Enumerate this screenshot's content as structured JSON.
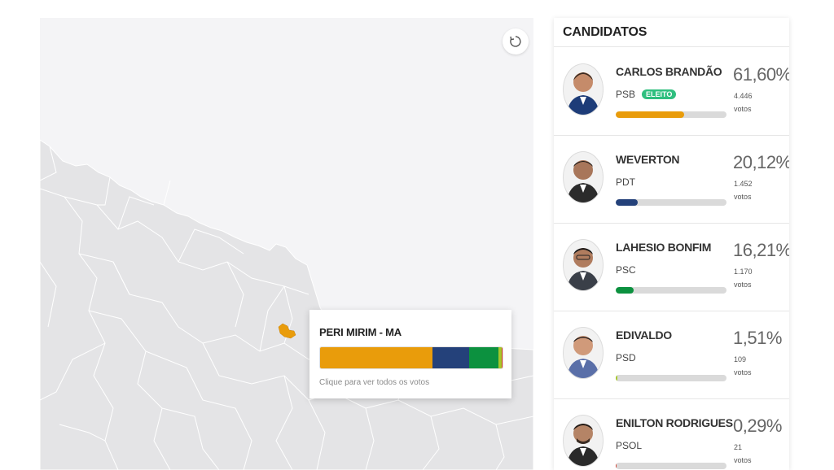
{
  "map": {
    "selected_municipality": "PERI MIRIM - MA",
    "hint": "Clique para ver todos os votos",
    "result_bar": [
      {
        "candidate": "CARLOS BRANDÃO",
        "share": 61.6,
        "color": "#e99c0b"
      },
      {
        "candidate": "WEVERTON",
        "share": 20.12,
        "color": "#24417a"
      },
      {
        "candidate": "LAHESIO BONFIM",
        "share": 16.21,
        "color": "#0c913f"
      },
      {
        "candidate": "EDIVALDO",
        "share": 1.51,
        "color": "#a5c72a"
      },
      {
        "candidate": "ENILTON RODRIGUES",
        "share": 0.29,
        "color": "#d23b2b"
      }
    ],
    "reset_icon": "refresh-icon",
    "highlight_color": "#e99c0b"
  },
  "candidates": {
    "header": "CANDIDATOS",
    "items": [
      {
        "name": "CARLOS BRANDÃO",
        "party": "PSB",
        "badge": "ELEITO",
        "percent": "61,60%",
        "votes": "4.446",
        "votes_label": "votos",
        "share": 61.6,
        "color": "#e99c0b"
      },
      {
        "name": "WEVERTON",
        "party": "PDT",
        "badge": "",
        "percent": "20,12%",
        "votes": "1.452",
        "votes_label": "votos",
        "share": 20.12,
        "color": "#24417a"
      },
      {
        "name": "LAHESIO BONFIM",
        "party": "PSC",
        "badge": "",
        "percent": "16,21%",
        "votes": "1.170",
        "votes_label": "votos",
        "share": 16.21,
        "color": "#0c913f"
      },
      {
        "name": "EDIVALDO",
        "party": "PSD",
        "badge": "",
        "percent": "1,51%",
        "votes": "109",
        "votes_label": "votos",
        "share": 1.51,
        "color": "#a5c72a"
      },
      {
        "name": "ENILTON RODRIGUES",
        "party": "PSOL",
        "badge": "",
        "percent": "0,29%",
        "votes": "21",
        "votes_label": "votos",
        "share": 0.29,
        "color": "#d23b2b"
      }
    ]
  }
}
